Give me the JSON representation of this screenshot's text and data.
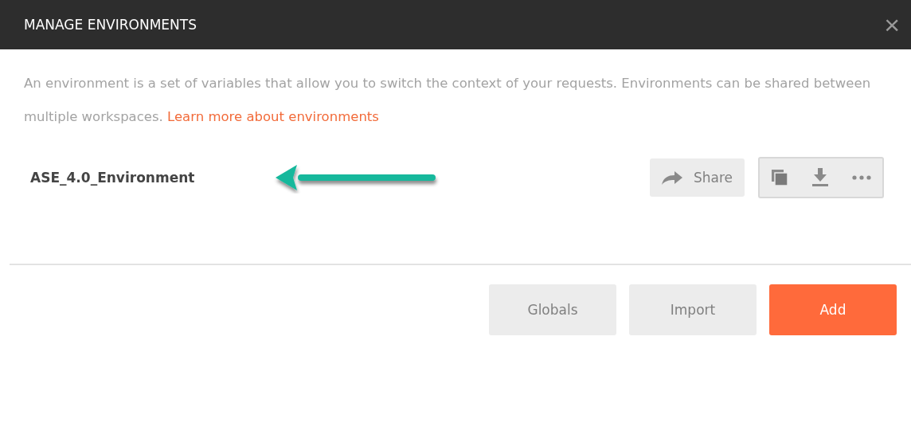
{
  "dialog": {
    "title": "MANAGE ENVIRONMENTS",
    "close": "×"
  },
  "description": {
    "text": "An environment is a set of variables that allow you to switch the context of your requests. Environments can be shared between multiple workspaces.",
    "link": "Learn more about environments"
  },
  "environments": [
    {
      "name": "ASE_4.0_Environment",
      "share_label": "Share"
    }
  ],
  "footer_buttons": [
    {
      "label": "Globals",
      "kind": "secondary"
    },
    {
      "label": "Import",
      "kind": "secondary"
    },
    {
      "label": "Add",
      "kind": "primary"
    }
  ]
}
